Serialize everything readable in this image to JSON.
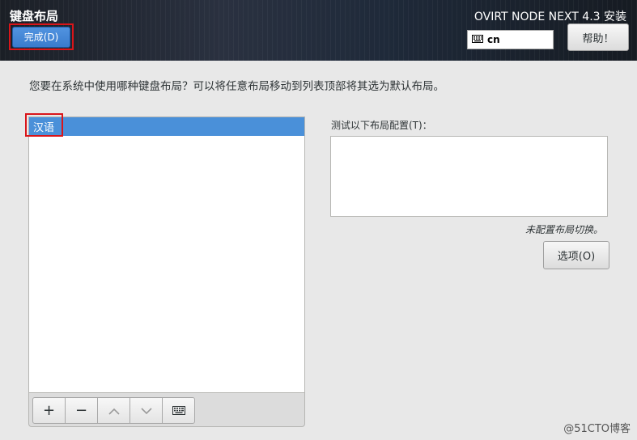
{
  "header": {
    "title": "键盘布局",
    "done_label": "完成(D)",
    "product": "OVIRT NODE NEXT 4.3 安装",
    "layout_indicator": "cn",
    "help_label": "帮助！"
  },
  "main": {
    "question": "您要在系统中使用哪种键盘布局？可以将任意布局移动到列表顶部将其选为默认布局。",
    "layouts": [
      {
        "label": "汉语",
        "selected": true
      }
    ],
    "test_label": "测试以下布局配置(T)：",
    "test_value": "",
    "no_switch_text": "未配置布局切换。",
    "options_label": "选项(O)"
  },
  "toolbar": {
    "add_label": "+",
    "remove_label": "−",
    "up_label": "∧",
    "down_label": "∨"
  },
  "watermark": "@51CTO博客",
  "colors": {
    "accent": "#4a90d9",
    "highlight_border": "#d9151a"
  }
}
